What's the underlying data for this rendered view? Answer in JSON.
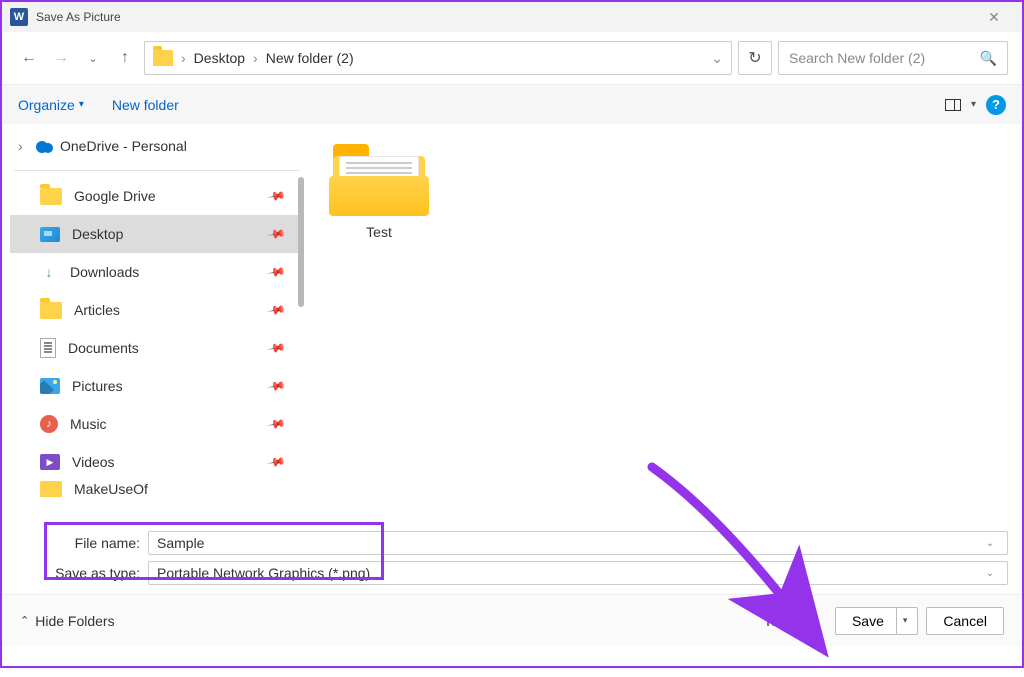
{
  "title": "Save As Picture",
  "breadcrumb": {
    "seg1": "Desktop",
    "seg2": "New folder (2)"
  },
  "search": {
    "placeholder": "Search New folder (2)"
  },
  "toolbar": {
    "organize": "Organize",
    "newfolder": "New folder"
  },
  "tree": {
    "onedrive": "OneDrive - Personal"
  },
  "sidebar": {
    "items": [
      {
        "label": "Google Drive"
      },
      {
        "label": "Desktop"
      },
      {
        "label": "Downloads"
      },
      {
        "label": "Articles"
      },
      {
        "label": "Documents"
      },
      {
        "label": "Pictures"
      },
      {
        "label": "Music"
      },
      {
        "label": "Videos"
      },
      {
        "label": "MakeUseOf"
      }
    ]
  },
  "content": {
    "folder1": "Test"
  },
  "inputs": {
    "filename_label": "File name:",
    "filename_value": "Sample",
    "saveas_label": "Save as type:",
    "saveas_value": "Portable Network Graphics (*.png)"
  },
  "buttons": {
    "hide_folders": "Hide Folders",
    "tools": "Tools",
    "save": "Save",
    "cancel": "Cancel"
  }
}
